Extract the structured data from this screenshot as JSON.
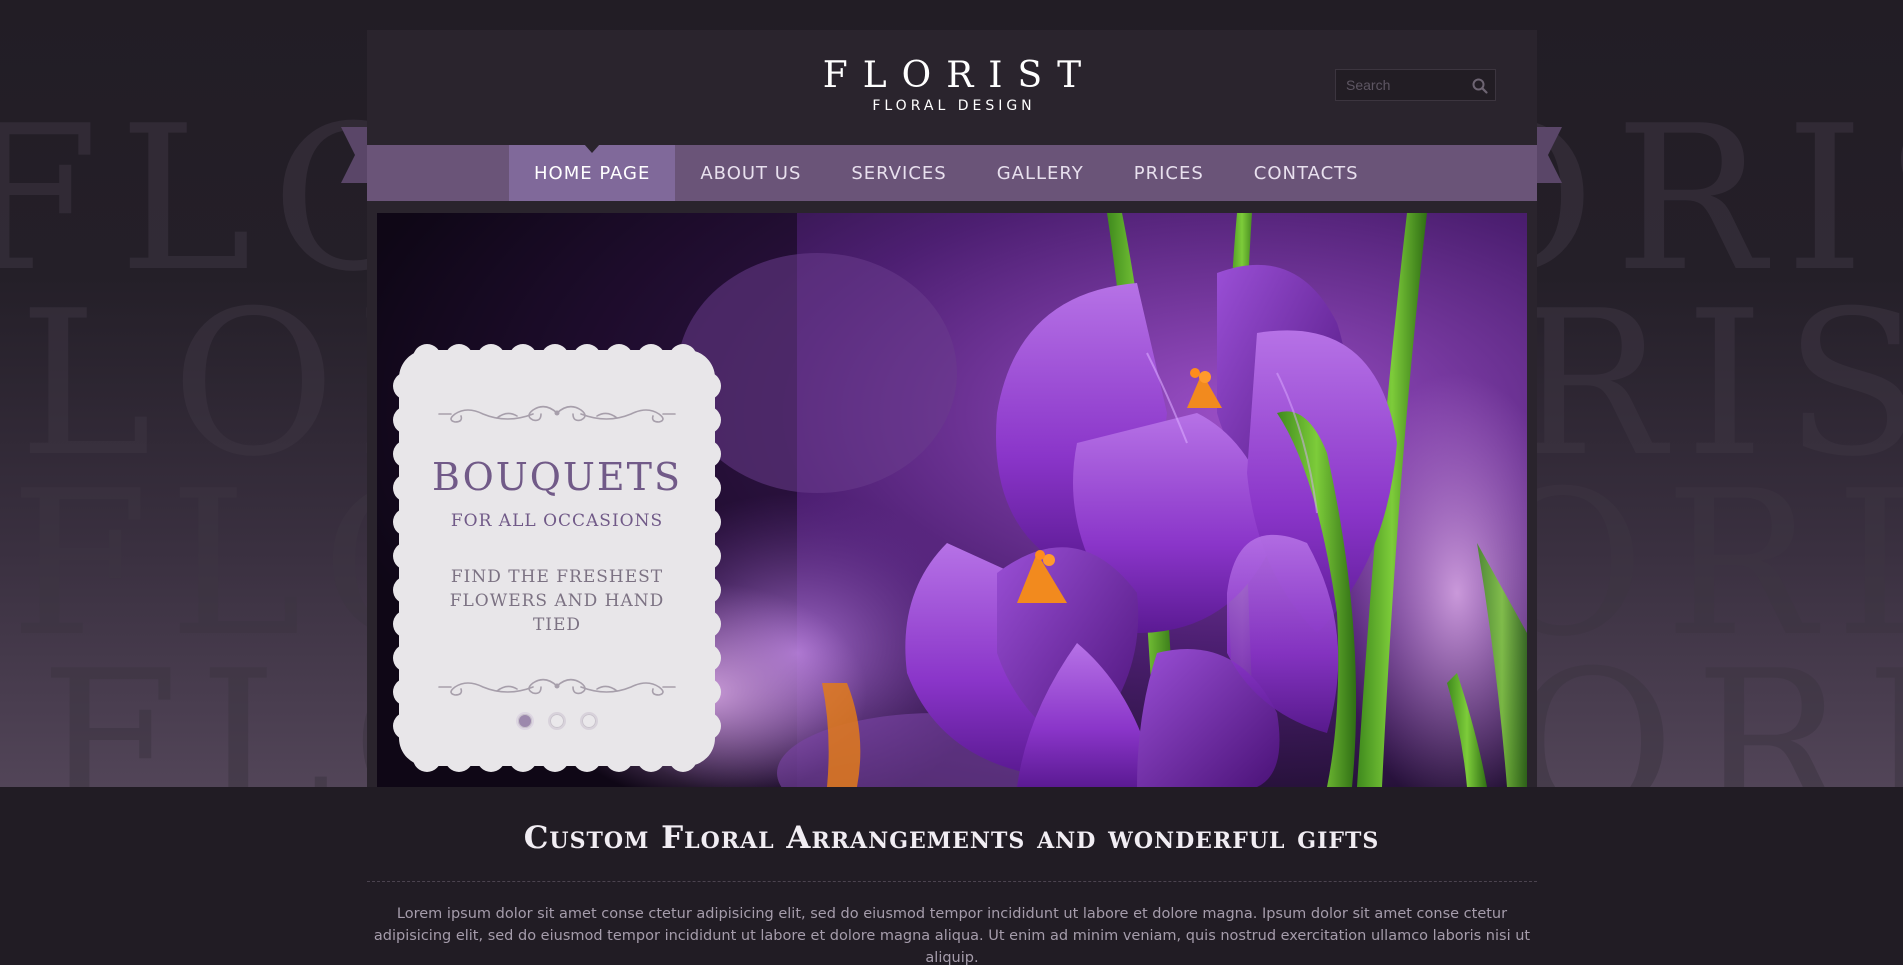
{
  "background": {
    "watermark_rows": [
      "FLORIST FLORIST",
      "FLORIST FLORIST",
      "FLORIST FLORIST",
      "FLORIST FLORIST"
    ]
  },
  "header": {
    "logo_title": "FLORIST",
    "logo_subtitle": "FLORAL DESIGN",
    "search_placeholder": "Search"
  },
  "nav": {
    "items": [
      {
        "label": "HOME PAGE",
        "active": true
      },
      {
        "label": "ABOUT US"
      },
      {
        "label": "SERVICES"
      },
      {
        "label": "GALLERY"
      },
      {
        "label": "PRICES"
      },
      {
        "label": "CONTACTS"
      }
    ]
  },
  "slider": {
    "title": "BOUQUETS",
    "subtitle": "FOR ALL OCCASIONS",
    "text": "FIND THE FRESHEST FLOWERS AND HAND TIED",
    "slides_count": 3,
    "active_slide": 1
  },
  "main": {
    "tagline": "Custom Floral Arrangements and wonderful gifts",
    "intro": "Lorem ipsum dolor sit amet conse ctetur adipisicing elit, sed do eiusmod tempor incididunt ut labore et dolore magna. Ipsum dolor sit amet conse ctetur adipisicing elit, sed do eiusmod tempor incididunt ut labore et dolore magna aliqua. Ut enim ad minim veniam, quis nostrud exercitation ullamco laboris nisi ut aliquip."
  },
  "icons": {
    "search": "search-icon",
    "ribbon": "ribbon-end-icon"
  },
  "colors": {
    "accent": "#6a5478",
    "accent_active": "#80699a",
    "background": "#211c24",
    "panel": "#2a242d"
  }
}
